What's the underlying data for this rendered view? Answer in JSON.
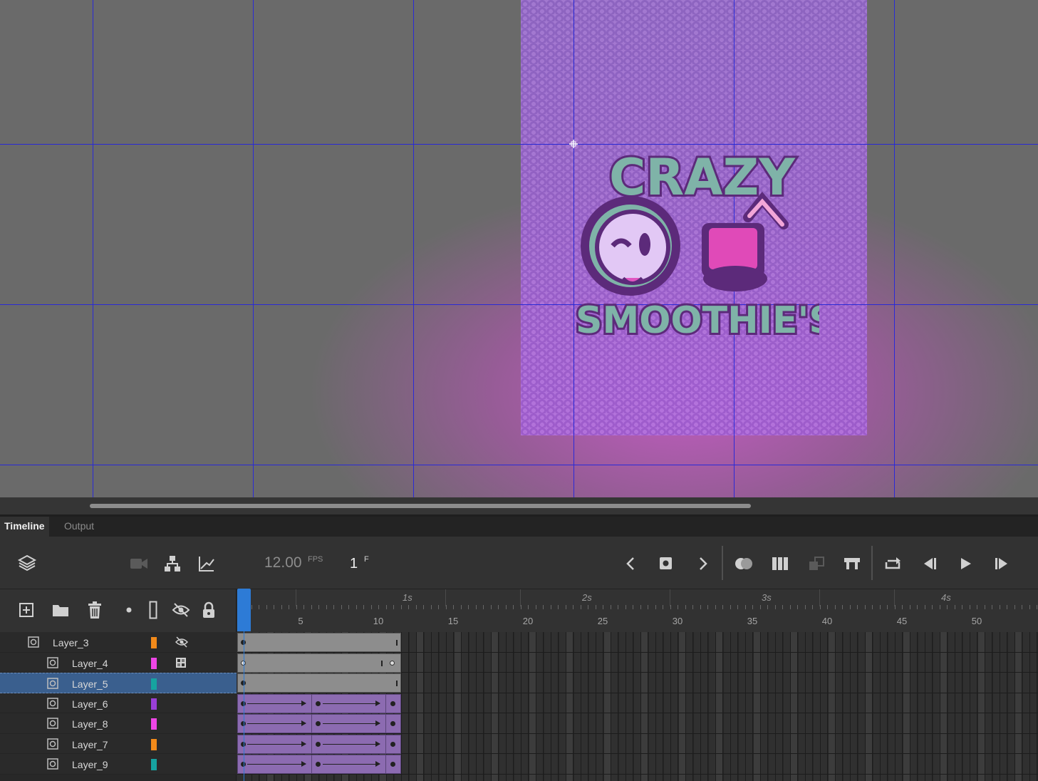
{
  "app": {
    "panel_tabs": [
      {
        "label": "Timeline",
        "active": true
      },
      {
        "label": "Output",
        "active": false
      }
    ]
  },
  "stage": {
    "logo_text_top": "CRAZY",
    "logo_text_bottom": "SMOOTHIE'S",
    "background_color": "#6a6a6a",
    "guide_color": "#2a2ad6"
  },
  "timeline": {
    "fps_value": "12.00",
    "fps_unit": "FPS",
    "current_frame": "1",
    "frame_unit": "F",
    "second_labels": [
      "1s",
      "2s",
      "3s",
      "4s"
    ],
    "frame_numbers": [
      "5",
      "10",
      "15",
      "20",
      "25",
      "30",
      "35",
      "40",
      "45",
      "50"
    ],
    "layers": [
      {
        "name": "Layer_3",
        "color": "#f28a1a",
        "selected": false,
        "extra_icon": "eye-hidden-icon",
        "frames": "gray",
        "indent": false
      },
      {
        "name": "Layer_4",
        "color": "#ee46e6",
        "selected": false,
        "extra_icon": "checker-icon",
        "frames": "gray-end",
        "indent": true
      },
      {
        "name": "Layer_5",
        "color": "#16a3a0",
        "selected": true,
        "extra_icon": "",
        "frames": "gray",
        "indent": true
      },
      {
        "name": "Layer_6",
        "color": "#9a3fd6",
        "selected": false,
        "extra_icon": "",
        "frames": "tween",
        "indent": true
      },
      {
        "name": "Layer_8",
        "color": "#ee46e6",
        "selected": false,
        "extra_icon": "",
        "frames": "tween",
        "indent": true
      },
      {
        "name": "Layer_7",
        "color": "#f28a1a",
        "selected": false,
        "extra_icon": "",
        "frames": "tween",
        "indent": true
      },
      {
        "name": "Layer_9",
        "color": "#16a3a0",
        "selected": false,
        "extra_icon": "",
        "frames": "tween",
        "indent": true
      }
    ],
    "accent_color": "#2d7bd6"
  }
}
